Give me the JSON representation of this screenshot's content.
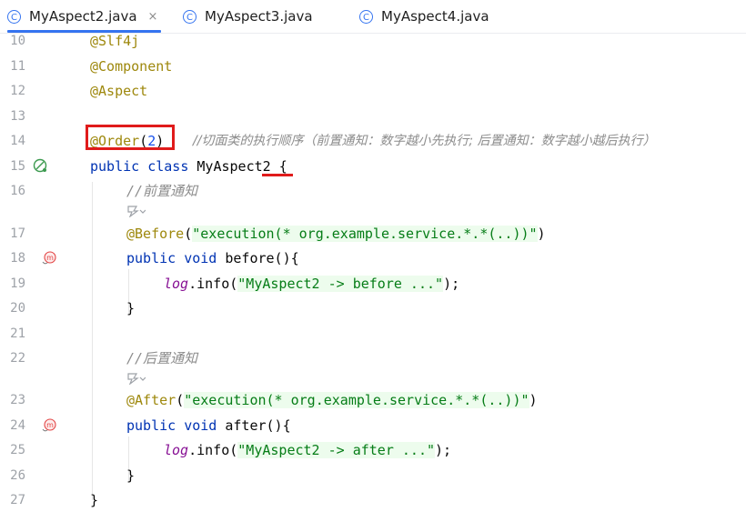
{
  "tabs": [
    {
      "label": "MyAspect2.java",
      "active": true,
      "close": "×"
    },
    {
      "label": "MyAspect3.java",
      "active": false
    },
    {
      "label": "MyAspect4.java",
      "active": false
    }
  ],
  "tab_icon_glyph": "C",
  "gutter": {
    "line_numbers": [
      "10",
      "11",
      "12",
      "13",
      "14",
      "15",
      "16",
      "17",
      "18",
      "19",
      "20",
      "21",
      "22",
      "23",
      "24",
      "25",
      "26",
      "27"
    ]
  },
  "code": {
    "l10": "@Slf4j",
    "l11": "@Component",
    "l12": "@Aspect",
    "l14_ann": "@Order",
    "l14_open": "(",
    "l14_num": "2",
    "l14_close": ")",
    "l14_comment": "//切面类的执行顺序（前置通知：数字越小先执行; 后置通知：数字越小越后执行）",
    "l15_kw": "public class",
    "l15_name": " MyAspect2 {",
    "l16_comment": "//前置通知",
    "l17_ann": "@Before",
    "l17_str": "\"execution(* org.example.service.*.*(..))\"",
    "l18_kw": "public void",
    "l18_rest": " before(){",
    "l19_field": "log",
    "l19_rest1": ".info(",
    "l19_str": "\"MyAspect2 -> before ...\"",
    "l19_rest2": ");",
    "l20": "}",
    "l22_comment": "//后置通知",
    "l23_ann": "@After",
    "l23_str": "\"execution(* org.example.service.*.*(..))\"",
    "l24_kw": "public void",
    "l24_rest": " after(){",
    "l25_field": "log",
    "l25_rest1": ".info(",
    "l25_str": "\"MyAspect2 -> after ...\"",
    "l25_rest2": ");",
    "l26": "}",
    "l27": "}"
  },
  "gutter_icons": {
    "spring_bean": "spring-bean-icon",
    "method_advice": "m-advice-icon"
  },
  "colors": {
    "accent": "#3574f0",
    "annotation": "#9e880d",
    "keyword": "#0033b3",
    "string": "#067d17",
    "comment": "#8c8c8c",
    "highlight_red": "#e01b1b"
  }
}
